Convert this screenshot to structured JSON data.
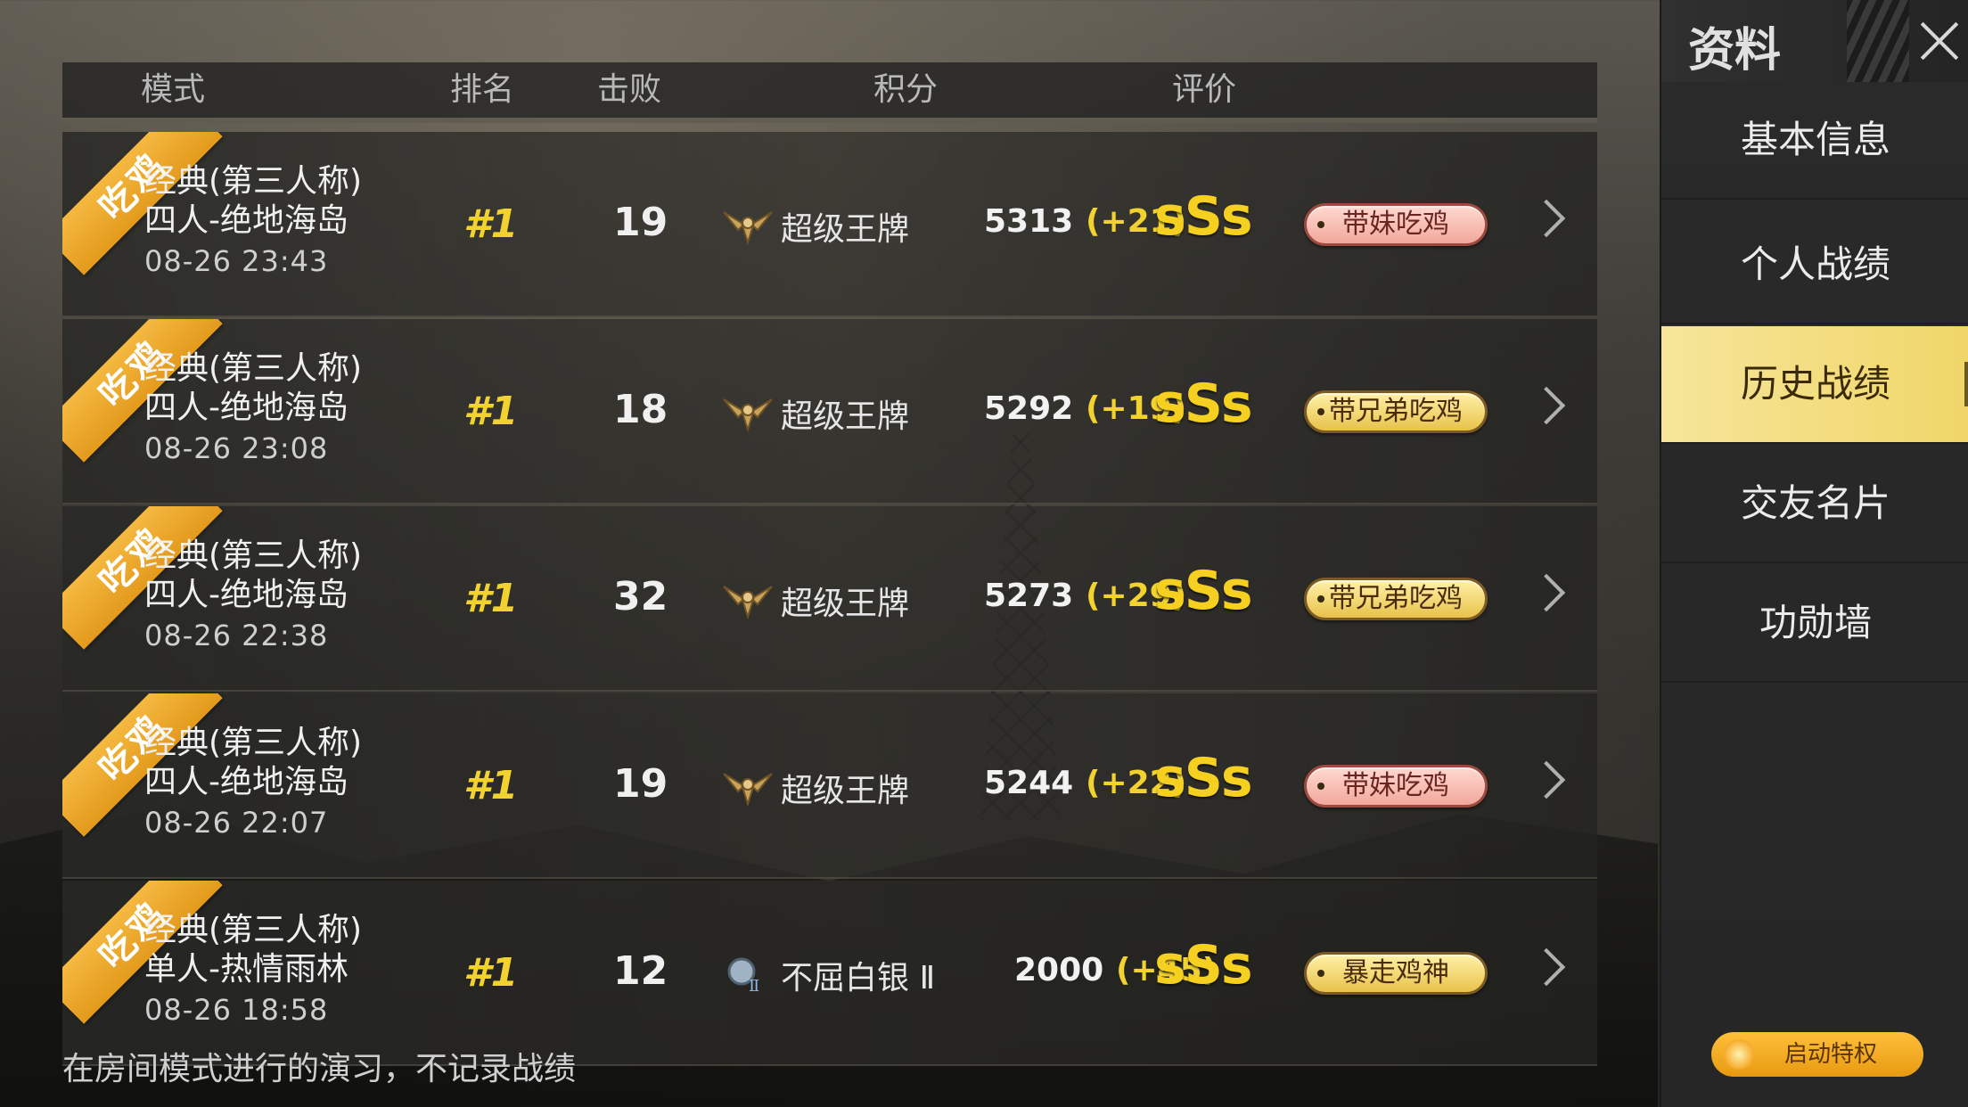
{
  "headers": {
    "mode": "模式",
    "rank": "排名",
    "kills": "击败",
    "score": "积分",
    "rating": "评价"
  },
  "rows": [
    {
      "ribbon": "吃鸡",
      "mode1": "经典(第三人称)",
      "mode2": "四人-绝地海岛",
      "time": "08-26 23:43",
      "rank": "#1",
      "kills": "19",
      "tier": "超级王牌",
      "score": "5313",
      "delta": "(+21)",
      "rating": "sSs",
      "badge": "带妹吃鸡",
      "badge_style": "pink"
    },
    {
      "ribbon": "吃鸡",
      "mode1": "经典(第三人称)",
      "mode2": "四人-绝地海岛",
      "time": "08-26 23:08",
      "rank": "#1",
      "kills": "18",
      "tier": "超级王牌",
      "score": "5292",
      "delta": "(+19)",
      "rating": "sSs",
      "badge": "带兄弟吃鸡",
      "badge_style": "gold"
    },
    {
      "ribbon": "吃鸡",
      "mode1": "经典(第三人称)",
      "mode2": "四人-绝地海岛",
      "time": "08-26 22:38",
      "rank": "#1",
      "kills": "32",
      "tier": "超级王牌",
      "score": "5273",
      "delta": "(+29)",
      "rating": "sSs",
      "badge": "带兄弟吃鸡",
      "badge_style": "gold"
    },
    {
      "ribbon": "吃鸡",
      "mode1": "经典(第三人称)",
      "mode2": "四人-绝地海岛",
      "time": "08-26 22:07",
      "rank": "#1",
      "kills": "19",
      "tier": "超级王牌",
      "score": "5244",
      "delta": "(+22)",
      "rating": "sSs",
      "badge": "带妹吃鸡",
      "badge_style": "pink"
    },
    {
      "ribbon": "吃鸡",
      "mode1": "经典(第三人称)",
      "mode2": "单人-热情雨林",
      "time": "08-26 18:58",
      "rank": "#1",
      "kills": "12",
      "tier": "不屈白银 Ⅱ",
      "score": "2000",
      "delta": "(+45)",
      "rating": "sSs",
      "badge": "暴走鸡神",
      "badge_style": "gold"
    }
  ],
  "footer_note": "在房间模式进行的演习，不记录战绩",
  "sidebar": {
    "title": "资料",
    "items": [
      {
        "label": "基本信息",
        "active": false
      },
      {
        "label": "个人战绩",
        "active": false
      },
      {
        "label": "历史战绩",
        "active": true
      },
      {
        "label": "交友名片",
        "active": false
      },
      {
        "label": "功勋墙",
        "active": false
      }
    ],
    "privilege_label": "启动特权"
  },
  "colors": {
    "accent_yellow": "#f2d22e",
    "ribbon_orange": "#e39a1c",
    "active_tab": "#f0d668"
  }
}
